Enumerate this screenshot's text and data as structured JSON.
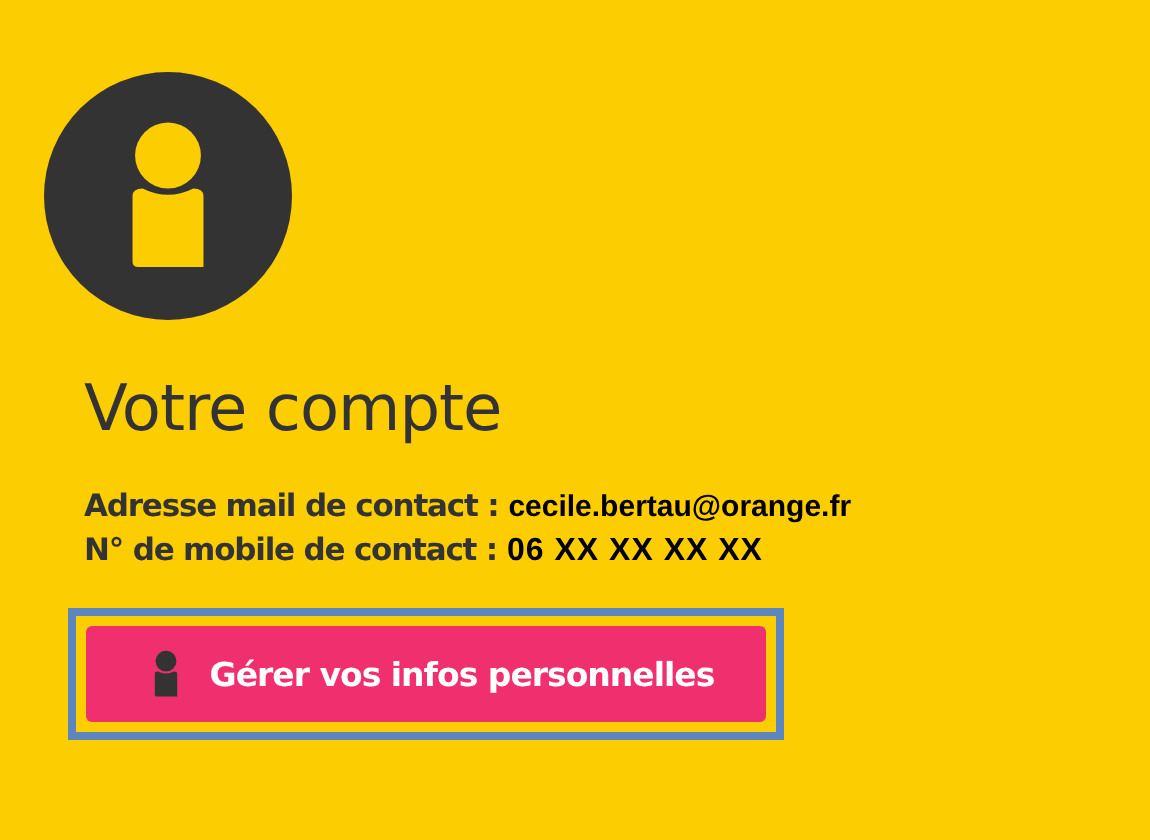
{
  "title": "Votre compte",
  "fields": [
    {
      "label": "Adresse mail de contact :",
      "value": "cecile.bertau@orange.fr",
      "kind": "email"
    },
    {
      "label": "N° de mobile de contact :",
      "value": "06 XX XX XX XX",
      "kind": "phone"
    }
  ],
  "button": {
    "label": "Gérer vos infos personnelles",
    "focused": true
  }
}
